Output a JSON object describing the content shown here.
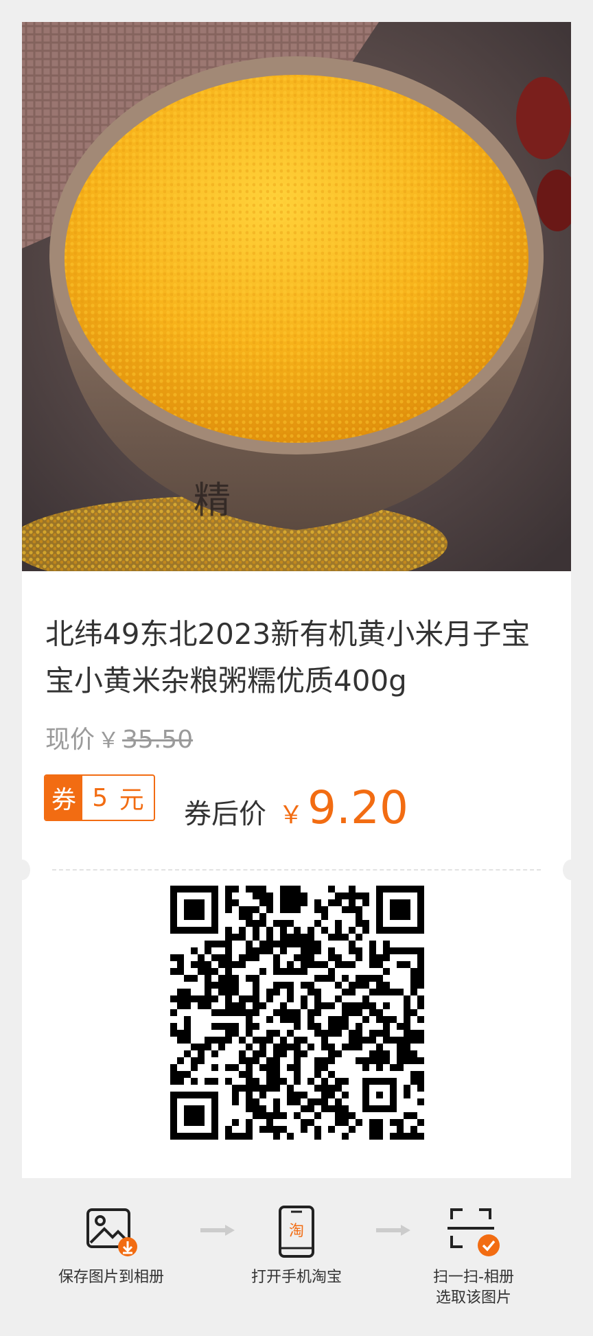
{
  "product": {
    "title": "北纬49东北2023新有机黄小米月子宝宝小黄米杂粮粥糯优质400g",
    "price_label": "现价",
    "currency": "￥",
    "original_price": "35.50",
    "coupon_tag": "券",
    "coupon_amount": "5",
    "coupon_unit": "元",
    "after_label": "券后价",
    "after_price": "9.20"
  },
  "steps": [
    {
      "label": "保存图片到相册",
      "icon": "save-image-icon"
    },
    {
      "label": "打开手机淘宝",
      "icon": "taobao-phone-icon",
      "badge": "淘"
    },
    {
      "label": "扫一扫-相册选取该图片",
      "label_line1": "扫一扫-相册",
      "label_line2": "选取该图片",
      "icon": "scan-icon"
    }
  ],
  "colors": {
    "accent": "#f26c12",
    "text": "#333333",
    "muted": "#9a9a9a"
  }
}
